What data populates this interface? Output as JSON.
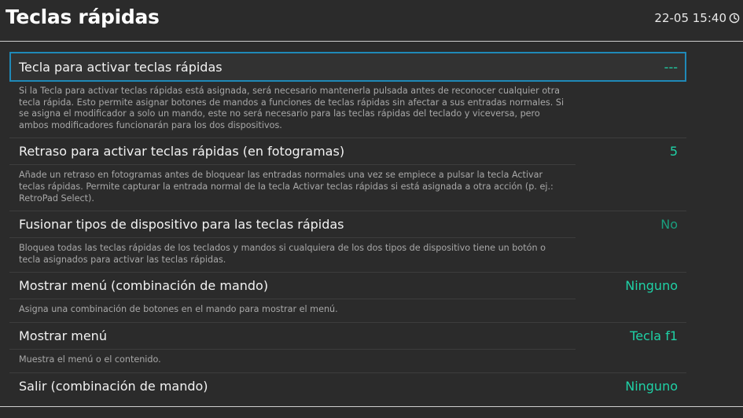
{
  "header": {
    "title": "Teclas rápidas",
    "datetime": "22-05 15:40",
    "clock_icon": "clock-icon"
  },
  "items": [
    {
      "label": "Tecla para activar teclas rápidas",
      "value": "---",
      "description": "Si la Tecla para activar teclas rápidas está asignada, será necesario mantenerla pulsada antes de reconocer cualquier otra tecla rápida. Esto permite asignar botones de mandos a funciones de teclas rápidas sin afectar a sus entradas normales. Si se asigna el modificador a solo un mando, este no será necesario para las teclas rápidas del teclado y viceversa, pero ambos modificadores funcionarán para los dos dispositivos."
    },
    {
      "label": "Retraso para activar teclas rápidas (en fotogramas)",
      "value": "5",
      "description": "Añade un retraso en fotogramas antes de bloquear las entradas normales una vez se empiece a pulsar la tecla Activar teclas rápidas. Permite capturar la entrada normal de la tecla Activar teclas rápidas si está asignada a otra acción (p. ej.: RetroPad Select)."
    },
    {
      "label": "Fusionar tipos de dispositivo para las teclas rápidas",
      "value": "No",
      "description": "Bloquea todas las teclas rápidas de los teclados y mandos si cualquiera de los dos tipos de dispositivo tiene un botón o tecla asignados para activar las teclas rápidas."
    },
    {
      "label": "Mostrar menú (combinación de mando)",
      "value": "Ninguno",
      "description": "Asigna una combinación de botones en el mando para mostrar el menú."
    },
    {
      "label": "Mostrar menú",
      "value": "Tecla f1",
      "description": "Muestra el menú o el contenido."
    },
    {
      "label": "Salir (combinación de mando)",
      "value": "Ninguno"
    }
  ],
  "colors": {
    "background": "#2b2b2b",
    "accent_value": "#1fd1a6",
    "dim_value": "#1a9e7e",
    "selection_border": "#1f89b8"
  }
}
